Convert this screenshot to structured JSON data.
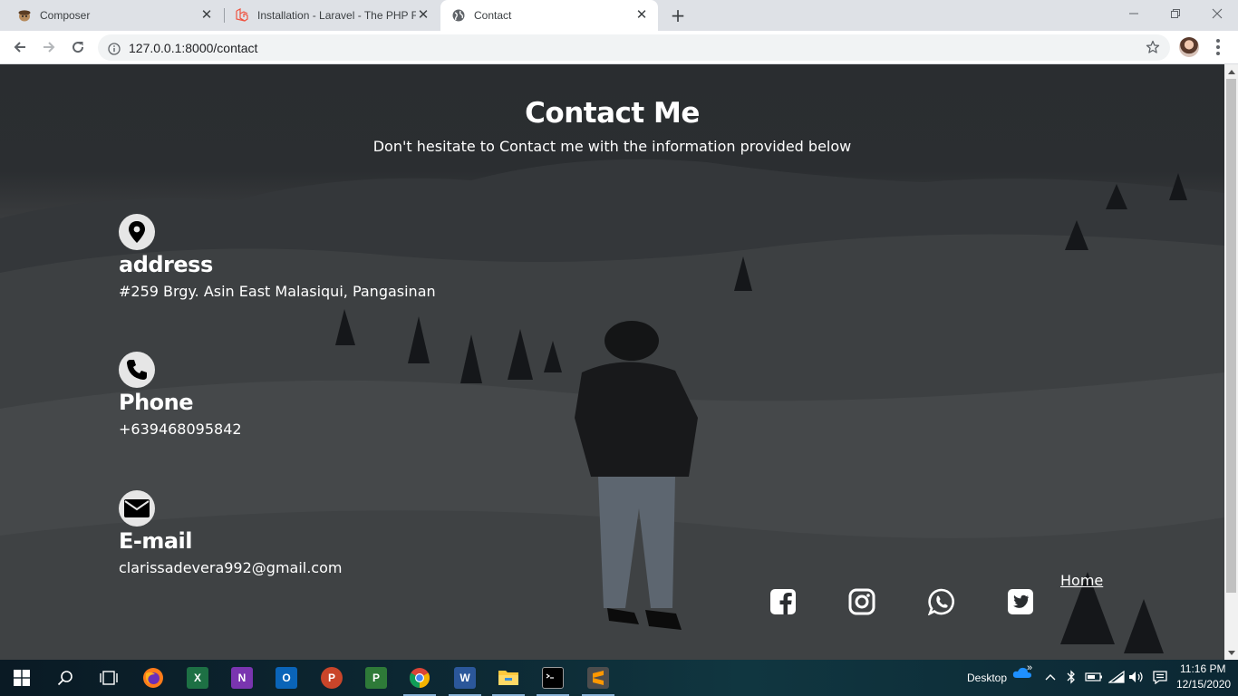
{
  "browser": {
    "tabs": [
      {
        "title": "Composer",
        "active": false,
        "icon": "composer-icon"
      },
      {
        "title": "Installation - Laravel - The PHP Fr",
        "active": false,
        "icon": "laravel-icon"
      },
      {
        "title": "Contact",
        "active": true,
        "icon": "globe-icon"
      }
    ],
    "url": "127.0.0.1:8000/contact"
  },
  "page": {
    "title": "Contact Me",
    "subtitle": "Don't hesitate to Contact me with the information provided below",
    "contacts": [
      {
        "icon": "map-pin-icon",
        "heading": "address",
        "value": "#259 Brgy. Asin East Malasiqui, Pangasinan"
      },
      {
        "icon": "phone-icon",
        "heading": "Phone",
        "value": "+639468095842"
      },
      {
        "icon": "envelope-icon",
        "heading": "E-mail",
        "value": "clarissadevera992@gmail.com"
      }
    ],
    "home_link": "Home",
    "social": [
      "facebook-icon",
      "instagram-icon",
      "whatsapp-icon",
      "twitter-icon"
    ]
  },
  "taskbar": {
    "apps": [
      "windows-start-icon",
      "search-icon",
      "task-view-icon",
      "firefox-icon",
      "excel-icon",
      "onenote-icon",
      "outlook-icon",
      "powerpoint-icon",
      "project-icon",
      "chrome-icon",
      "word-icon",
      "file-explorer-icon",
      "terminal-icon",
      "sublime-icon"
    ],
    "desktop_label": "Desktop",
    "time": "11:16 PM",
    "date": "12/15/2020"
  }
}
